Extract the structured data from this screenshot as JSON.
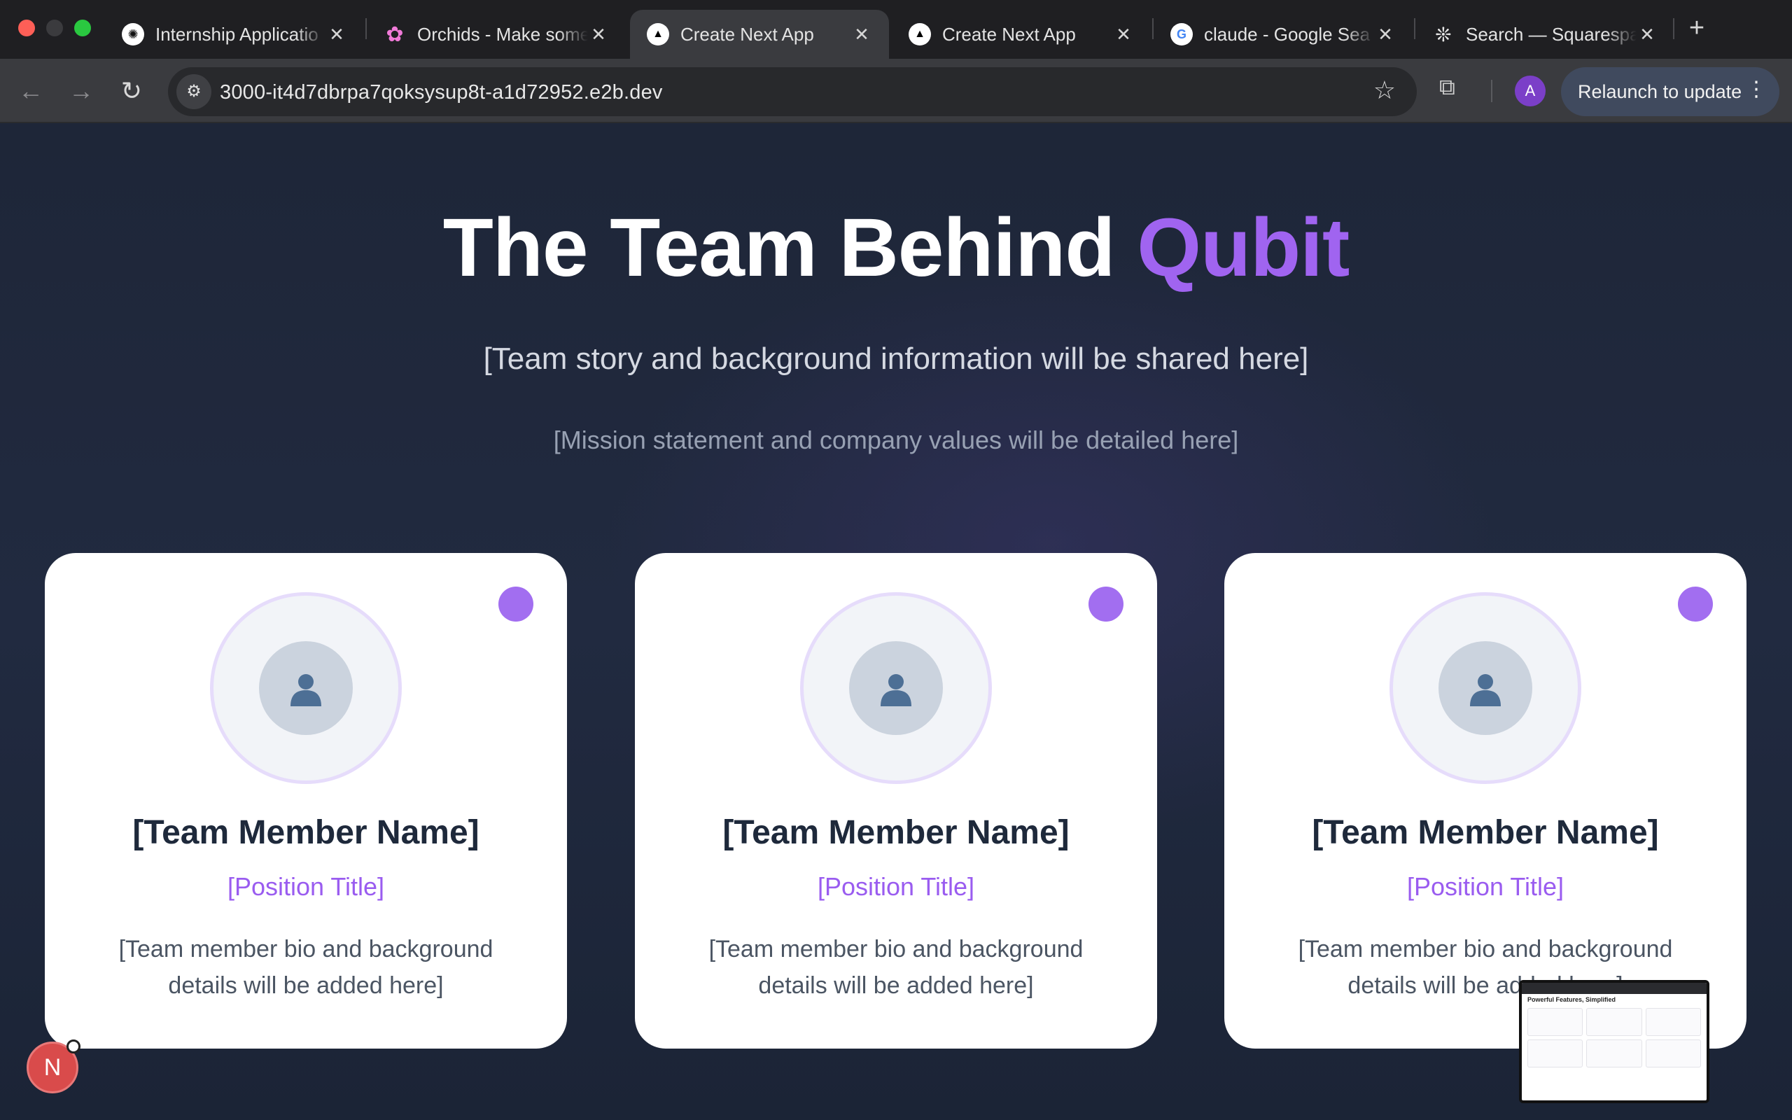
{
  "browser": {
    "tabs": [
      {
        "title": "Internship Applicatio",
        "favicon": "openai-icon",
        "active": false
      },
      {
        "title": "Orchids - Make some",
        "favicon": "orchids-icon",
        "active": false
      },
      {
        "title": "Create Next App",
        "favicon": "nextjs-icon",
        "active": true
      },
      {
        "title": "Create Next App",
        "favicon": "nextjs-icon",
        "active": false
      },
      {
        "title": "claude - Google Sea",
        "favicon": "google-icon",
        "active": false
      },
      {
        "title": "Search — Squarespa",
        "favicon": "squarespace-icon",
        "active": false
      }
    ],
    "url": "3000-it4d7dbrpa7qoksysup8t-a1d72952.e2b.dev",
    "profile_initial": "A",
    "relaunch_label": "Relaunch to update"
  },
  "hero": {
    "title_main": "The Team Behind ",
    "title_accent": "Qubit",
    "subtitle": "[Team story and background information will be shared here]",
    "mission": "[Mission statement and company values will be detailed here]"
  },
  "team": [
    {
      "name": "[Team Member Name]",
      "position": "[Position Title]",
      "bio": "[Team member bio and background details will be added here]"
    },
    {
      "name": "[Team Member Name]",
      "position": "[Position Title]",
      "bio": "[Team member bio and background details will be added here]"
    },
    {
      "name": "[Team Member Name]",
      "position": "[Position Title]",
      "bio": "[Team member bio and background details will be added here]"
    }
  ],
  "dev_badge": {
    "label": "N"
  },
  "preview_thumbnail": {
    "title": "Powerful Features, Simplified"
  },
  "colors": {
    "accent": "#a064f0",
    "page_bg": "#1e2638",
    "card_bg": "#ffffff"
  }
}
